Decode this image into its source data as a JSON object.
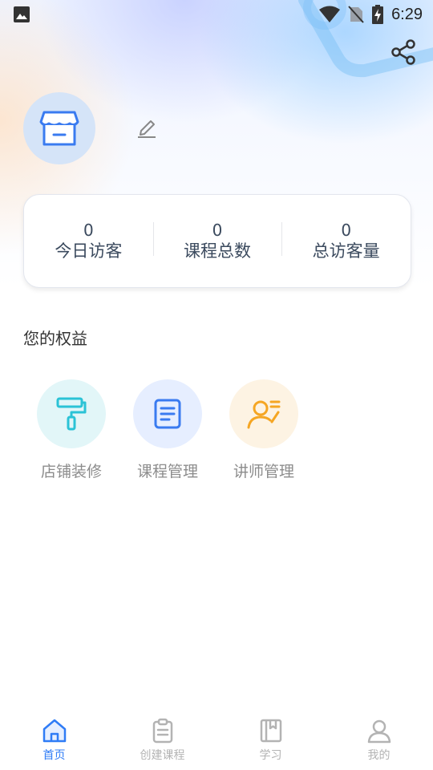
{
  "status_bar": {
    "time": "6:29",
    "icons": [
      "image-icon",
      "wifi-icon",
      "no-sim-icon",
      "battery-charging-icon"
    ]
  },
  "header": {
    "share_icon": "share-icon",
    "avatar_icon": "store-icon",
    "edit_icon": "pencil-icon"
  },
  "stats": [
    {
      "value": "0",
      "label": "今日访客"
    },
    {
      "value": "0",
      "label": "课程总数"
    },
    {
      "value": "0",
      "label": "总访客量"
    }
  ],
  "benefits_section": {
    "title": "您的权益",
    "items": [
      {
        "label": "店铺装修",
        "icon": "paint-roller-icon",
        "color": "#2bc3d6",
        "bg": "#e2f6f8"
      },
      {
        "label": "课程管理",
        "icon": "document-icon",
        "color": "#3a7bf0",
        "bg": "#e6eeff"
      },
      {
        "label": "讲师管理",
        "icon": "user-list-icon",
        "color": "#f5a623",
        "bg": "#fdf3e3"
      }
    ]
  },
  "tabbar": {
    "active": 0,
    "items": [
      {
        "label": "首页",
        "icon": "home-icon"
      },
      {
        "label": "创建课程",
        "icon": "clipboard-icon"
      },
      {
        "label": "学习",
        "icon": "book-icon"
      },
      {
        "label": "我的",
        "icon": "user-icon"
      }
    ]
  },
  "colors": {
    "accent": "#2f7cf6",
    "inactive": "#b3b3b3",
    "stat_text": "#3b4a5e"
  }
}
